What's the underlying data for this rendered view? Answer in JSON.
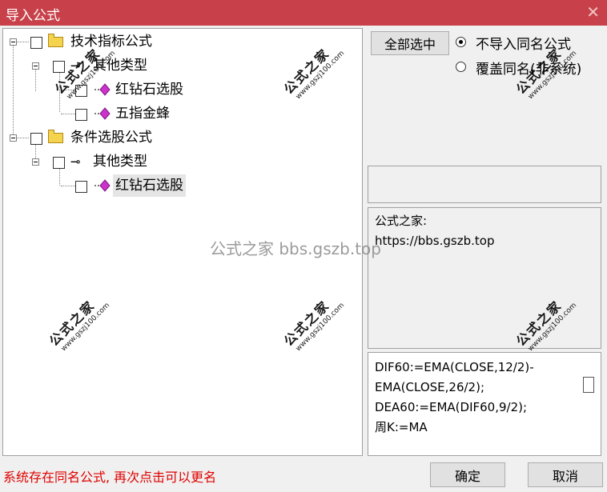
{
  "window": {
    "title": "导入公式",
    "close_glyph": "✕"
  },
  "tree": {
    "nodes": [
      {
        "label": "技术指标公式",
        "icon": "folder-icon"
      },
      {
        "label": "其他类型",
        "icon": "key-icon"
      },
      {
        "label": "红钻石选股",
        "icon": "gem-icon"
      },
      {
        "label": "五指金蜂",
        "icon": "gem-icon"
      },
      {
        "label": "条件选股公式",
        "icon": "folder-icon"
      },
      {
        "label": "其他类型",
        "icon": "key-icon"
      },
      {
        "label": "红钻石选股",
        "icon": "gem-icon"
      }
    ]
  },
  "options": {
    "select_all_label": "全部选中",
    "radio_skip_label": "不导入同名公式",
    "radio_overwrite_label": "覆盖同名(非系统)"
  },
  "info": {
    "line1": "公式之家:",
    "line2": "https://bbs.gszb.top"
  },
  "code": {
    "text": "DIF60:=EMA(CLOSE,12/2)-EMA(CLOSE,26/2);\nDEA60:=EMA(DIF60,9/2);\n周K:=MA"
  },
  "status": {
    "message": "系统存在同名公式, 再次点击可以更名"
  },
  "footer": {
    "ok_label": "确定",
    "cancel_label": "取消"
  },
  "watermarks": {
    "stamp_title": "公式之家",
    "stamp_url": "www.gszj100.com",
    "center_text": "公式之家 bbs.gszb.top"
  },
  "colors": {
    "titlebar": "#c8414a",
    "status_text": "#e00000",
    "gem": "#cc33cc",
    "folder": "#f5d34f"
  }
}
